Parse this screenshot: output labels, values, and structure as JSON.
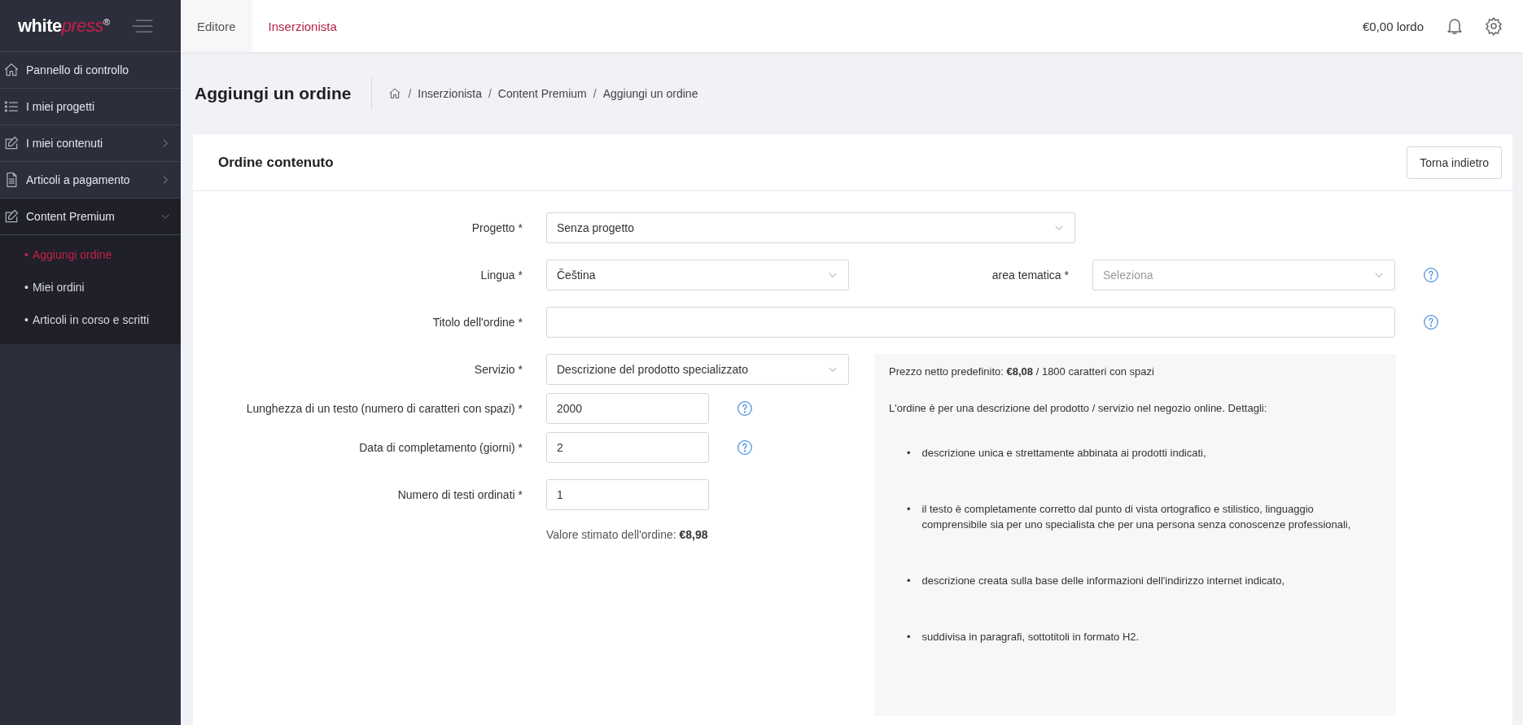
{
  "logo": {
    "main": "white",
    "accent": "press",
    "mark": "®"
  },
  "top_tabs": [
    {
      "label": "Editore",
      "selected": false
    },
    {
      "label": "Inserzionista",
      "selected": true
    }
  ],
  "balance": "€0,00 lordo",
  "sidebar": {
    "items": [
      {
        "label": "Pannello di controllo"
      },
      {
        "label": "I miei progetti"
      },
      {
        "label": "I miei contenuti",
        "expanded": false
      },
      {
        "label": "Articoli a pagamento",
        "expanded": false
      },
      {
        "label": "Content Premium",
        "expanded": true,
        "children": [
          {
            "marker": "•",
            "label": "Aggiungi ordine",
            "selected": true
          },
          {
            "marker": "•",
            "label": "Miei ordini",
            "selected": false
          },
          {
            "marker": "•",
            "label": "Articoli in corso e scritti",
            "selected": false
          }
        ]
      }
    ]
  },
  "page_title": "Aggiungi un ordine",
  "breadcrumb": [
    {
      "separator": "/",
      "label": "Inserzionista"
    },
    {
      "separator": "/",
      "label": "Content Premium"
    },
    {
      "separator": "/",
      "label": "Aggiungi un ordine"
    }
  ],
  "card": {
    "title": "Ordine contenuto",
    "back_button": "Torna indietro"
  },
  "form": {
    "project": {
      "label": "Progetto *",
      "value": "Senza progetto"
    },
    "language": {
      "label": "Lingua *",
      "value": "Čeština"
    },
    "topic": {
      "label": "area tematica *",
      "placeholder": "Seleziona",
      "help": true
    },
    "order_title": {
      "label": "Titolo dell'ordine *",
      "help": true
    },
    "service": {
      "label": "Servizio *",
      "value": "Descrizione del prodotto specializzato"
    },
    "length": {
      "label": "Lunghezza di un testo (numero di caratteri con spazi) *",
      "value": "2000",
      "help": true
    },
    "days": {
      "label": "Data di completamento (giorni) *",
      "value": "2",
      "help": true
    },
    "count": {
      "label": "Numero di testi ordinati *",
      "value": "1",
      "help": false
    },
    "estimate": "Valore stimato dell'ordine: **€8,98**"
  },
  "info": {
    "price": "Prezzo netto predefinito: **€8,08** / 1800 caratteri con spazi",
    "intro": "L'ordine è per una descrizione del prodotto / servizio nel negozio online. Dettagli:",
    "bullets": [
      {
        "marker": "•",
        "text": "descrizione unica e strettamente abbinata ai prodotti indicati,"
      },
      {
        "marker": "•",
        "text": "il testo è completamente corretto dal punto di vista ortografico e stilistico, linguaggio comprensibile sia per uno specialista che per una persona senza conoscenze professionali,"
      },
      {
        "marker": "•",
        "text": "descrizione creata sulla base delle informazioni dell'indirizzo internet indicato,"
      },
      {
        "marker": "•",
        "text": "suddivisa in paragrafi, sottotitoli in formato H2."
      }
    ]
  }
}
